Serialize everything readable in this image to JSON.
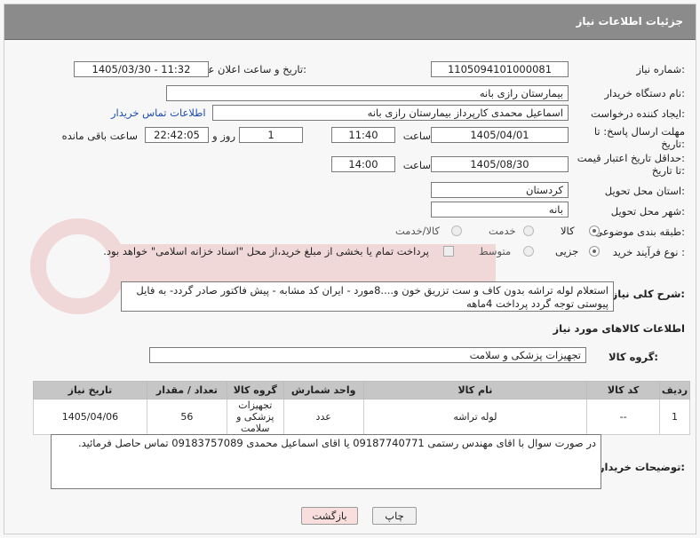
{
  "header": {
    "title": "جزئیات اطلاعات نیاز"
  },
  "fields": {
    "need_number_label": "شماره نیاز:",
    "need_number": "1105094101000081",
    "announce_label": "تاریخ و ساعت اعلان عمومی:",
    "announce_value": "1405/03/30 - 11:32",
    "buyer_org_label": "نام دستگاه خریدار:",
    "buyer_org": "بیمارستان رازی بانه",
    "creator_label": "ایجاد کننده درخواست:",
    "creator": "اسماعیل محمدی کارپرداز بیمارستان رازی بانه",
    "contact_link": "اطلاعات تماس خریدار",
    "deadline_label_1": "مهلت ارسال پاسخ: تا",
    "deadline_label_2": "تاریخ:",
    "deadline_date": "1405/04/01",
    "time_label": "ساعت",
    "deadline_time": "11:40",
    "days_value": "1",
    "days_label": "روز و",
    "remaining_time": "22:42:05",
    "remaining_label": "ساعت باقی مانده",
    "price_label_1": "حداقل تاریخ اعتبار قیمت:",
    "price_label_2": "تا تاریخ:",
    "price_date": "1405/08/30",
    "price_time": "14:00",
    "province_label": "استان محل تحویل:",
    "province": "کردستان",
    "city_label": "شهر محل تحویل:",
    "city": "بانه",
    "category_label": "طبقه بندی موضوعی:",
    "category_options": [
      "کالا",
      "خدمت",
      "کالا/خدمت"
    ],
    "process_label": "نوع فرآیند خرید :",
    "process_options": [
      "جزیی",
      "متوسط"
    ],
    "payment_note": "پرداخت تمام یا بخشی از مبلغ خرید،از محل \"اسناد خزانه اسلامی\" خواهد بود."
  },
  "description": {
    "label": "شرح کلی نیاز:",
    "text": "استعلام  لوله تراشه بدون کاف و ست تزریق خون و....8مورد - ایران کد مشابه - پیش فاکتور صادر گردد- به فایل پیوستی توجه گردد پرداخت 4ماهه"
  },
  "goods_info_title": "اطلاعات کالاهای مورد نیاز",
  "goods_group": {
    "label": "گروه کالا:",
    "value": "تجهیزات پزشکی و سلامت"
  },
  "table": {
    "columns": [
      "ردیف",
      "کد کالا",
      "نام کالا",
      "واحد شمارش",
      "گروه کالا",
      "تعداد / مقدار",
      "تاریخ نیاز"
    ],
    "rows": [
      [
        "1",
        "--",
        "لوله تراشه",
        "عدد",
        "تجهیزات پزشکی و سلامت",
        "56",
        "1405/04/06"
      ]
    ]
  },
  "buyer_notes": {
    "label": "توضیحات خریدار:",
    "text": "در صورت سوال با اقای مهندس رستمی 09187740771 یا اقای اسماعیل محمدی 09183757089 تماس حاصل فرمائید."
  },
  "buttons": {
    "print": "چاپ",
    "back": "بازگشت"
  },
  "colors": {
    "header_bg": "#8b8b8b",
    "back_bg": "#f9dede",
    "link": "#1a4db3"
  }
}
